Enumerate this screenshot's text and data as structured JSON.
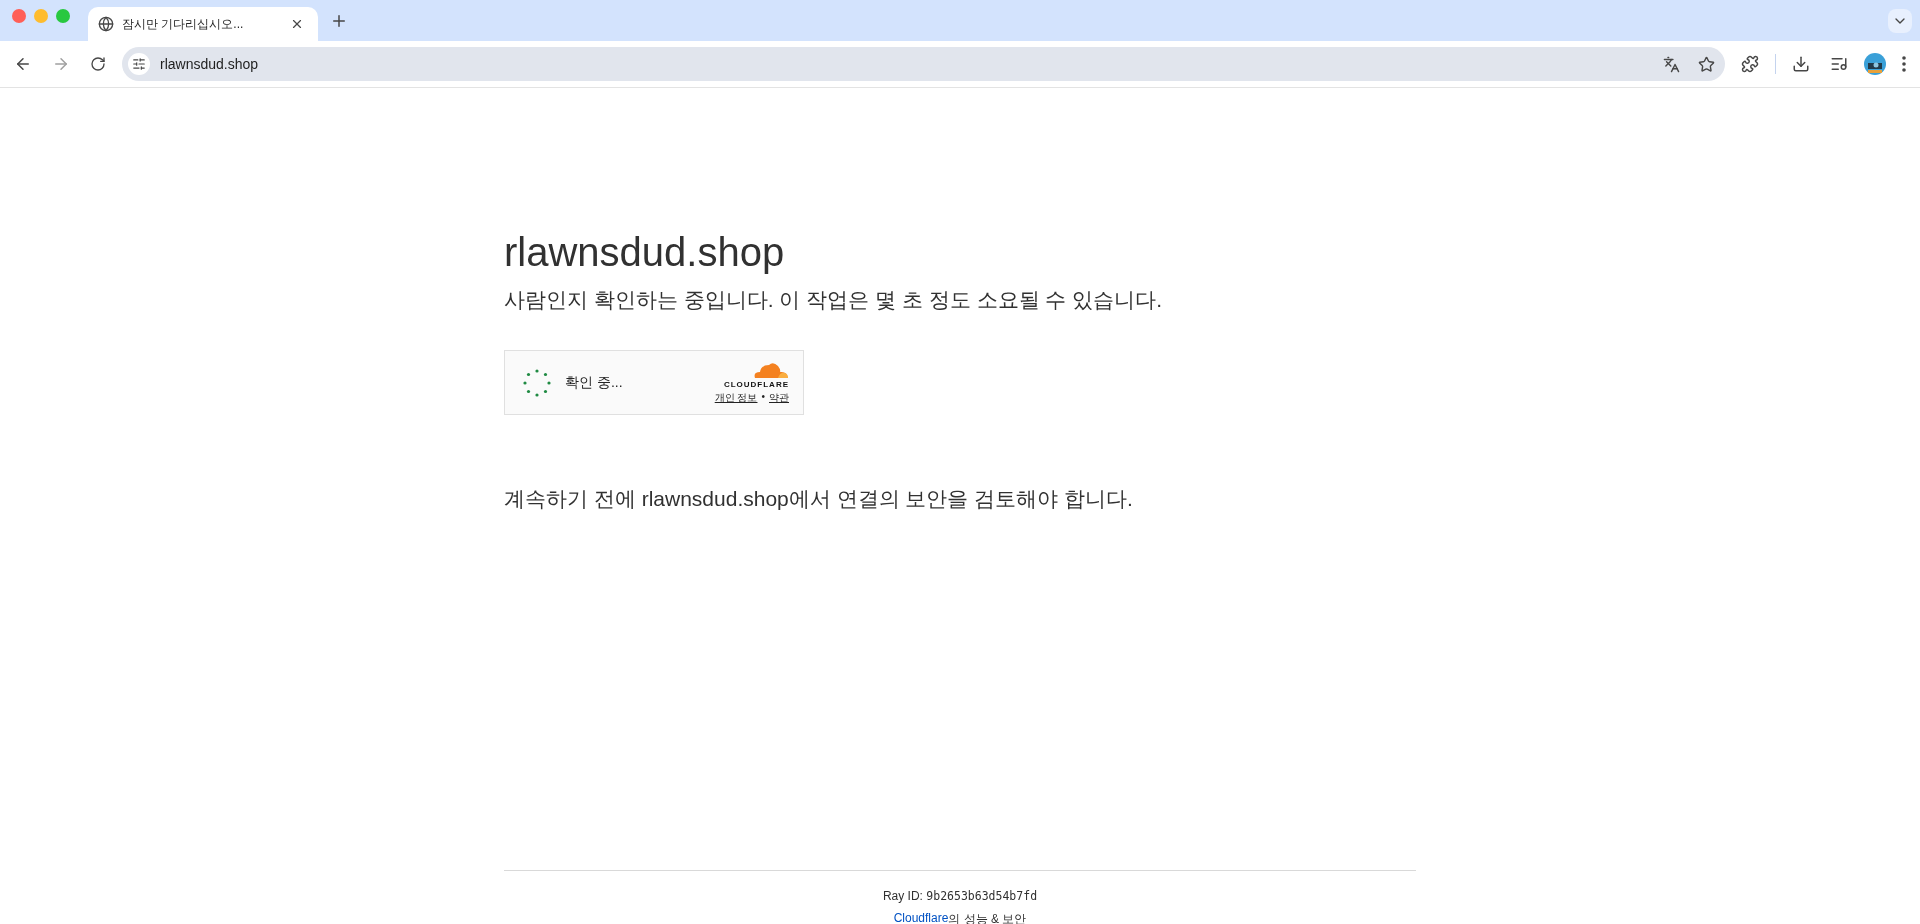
{
  "browser": {
    "tabs": [
      {
        "title": "잠시만 기다리십시오...",
        "selected": true
      }
    ],
    "address": "rlawnsdud.shop"
  },
  "page": {
    "title": "rlawnsdud.shop",
    "subtitle": "사람인지 확인하는 중입니다. 이 작업은 몇 초 정도 소요될 수 있습니다.",
    "widget": {
      "status": "확인 중...",
      "brand": "CLOUDFLARE",
      "privacy": "개인 정보",
      "separator": "•",
      "terms": "약관"
    },
    "notice": "계속하기 전에 rlawnsdud.shop에서 연결의 보안을 검토해야 합니다.",
    "footer": {
      "ray_label": "Ray ID: ",
      "ray_id": "9b2653b63d54b7fd",
      "link": "Cloudflare",
      "link_suffix": "의 성능 & 보안"
    }
  }
}
